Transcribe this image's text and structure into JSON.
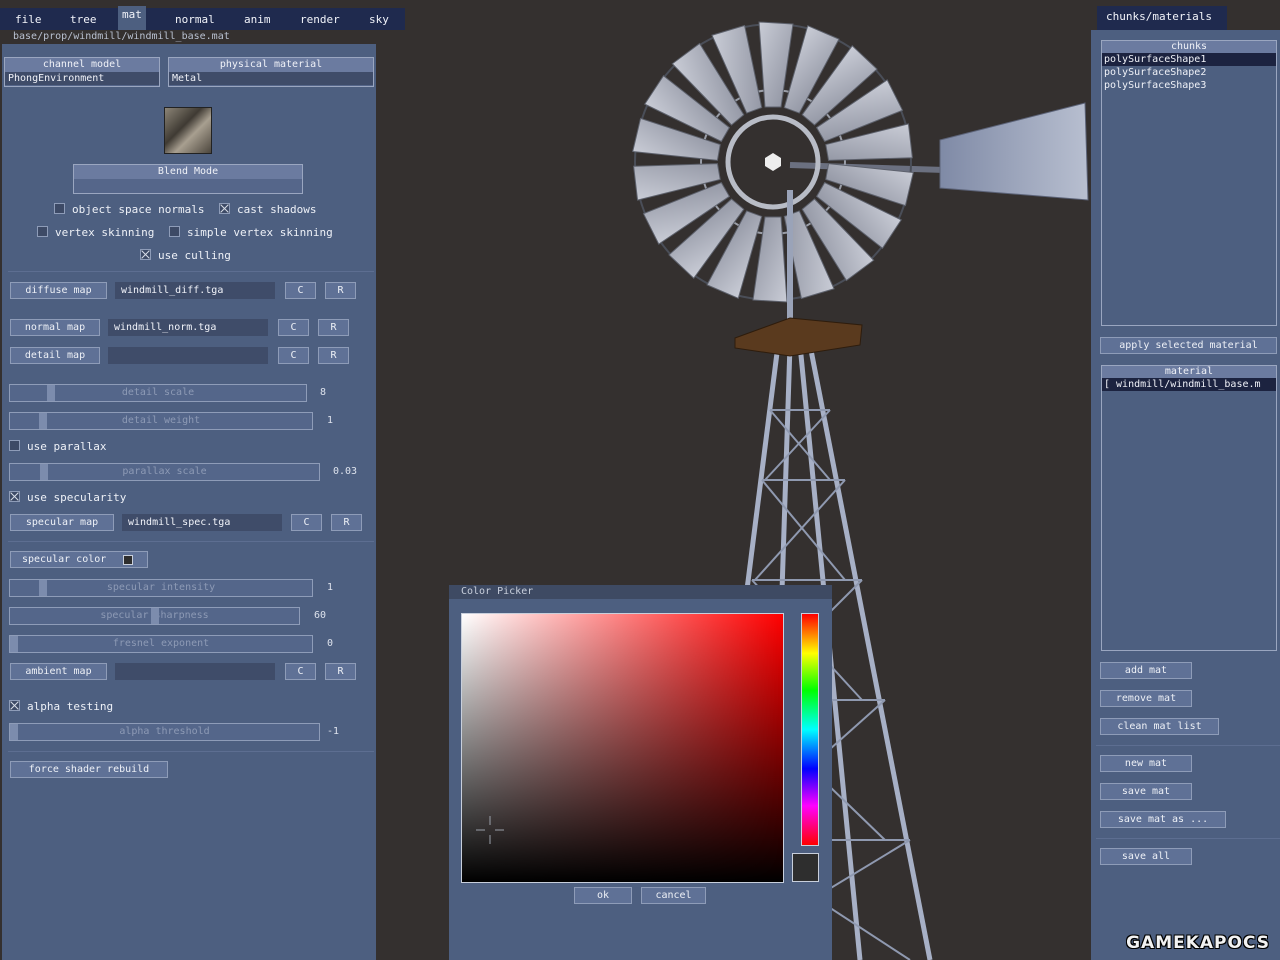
{
  "menu": {
    "items": [
      "file",
      "tree",
      "mat",
      "normal",
      "anim",
      "render",
      "sky"
    ],
    "active": "mat"
  },
  "path": "base/prop/windmill/windmill_base.mat",
  "left": {
    "channel_model": {
      "label": "channel model",
      "value": "PhongEnvironment"
    },
    "physical_material": {
      "label": "physical material",
      "value": "Metal"
    },
    "blend_mode": "Blend Mode",
    "checks": {
      "object_space_normals": {
        "label": "object space normals",
        "checked": false
      },
      "cast_shadows": {
        "label": "cast shadows",
        "checked": true
      },
      "vertex_skinning": {
        "label": "vertex skinning",
        "checked": false
      },
      "simple_vertex_skinning": {
        "label": "simple vertex skinning",
        "checked": false
      },
      "use_culling": {
        "label": "use culling",
        "checked": true
      },
      "use_parallax": {
        "label": "use parallax",
        "checked": false
      },
      "use_specularity": {
        "label": "use specularity",
        "checked": true
      },
      "alpha_testing": {
        "label": "alpha testing",
        "checked": true
      }
    },
    "maps": {
      "diffuse": {
        "label": "diffuse map",
        "file": "windmill_diff.tga"
      },
      "normal": {
        "label": "normal map",
        "file": "windmill_norm.tga"
      },
      "detail": {
        "label": "detail map",
        "file": ""
      },
      "specular": {
        "label": "specular map",
        "file": "windmill_spec.tga"
      },
      "ambient": {
        "label": "ambient map",
        "file": ""
      }
    },
    "c_label": "C",
    "r_label": "R",
    "sliders": {
      "detail_scale": {
        "label": "detail scale",
        "value": "8",
        "fraction": 0.13
      },
      "detail_weight": {
        "label": "detail weight",
        "value": "1",
        "fraction": 0.1
      },
      "parallax_scale": {
        "label": "parallax scale",
        "value": "0.03",
        "fraction": 0.1
      },
      "specular_intensity": {
        "label": "specular intensity",
        "value": "1",
        "fraction": 0.1
      },
      "specular_sharpness": {
        "label": "specular sharpness",
        "value": "60",
        "fraction": 0.5
      },
      "fresnel_exponent": {
        "label": "fresnel exponent",
        "value": "0",
        "fraction": 0.0
      },
      "alpha_threshold": {
        "label": "alpha threshold",
        "value": "-1",
        "fraction": 0.0
      }
    },
    "specular_color": "specular color",
    "force_rebuild": "force shader rebuild"
  },
  "right": {
    "tab": "chunks/materials",
    "chunks_header": "chunks",
    "chunks": [
      "polySurfaceShape1",
      "polySurfaceShape2",
      "polySurfaceShape3"
    ],
    "selected_chunk": 0,
    "apply_selected": "apply selected material",
    "material_header": "material",
    "materials": [
      "[ windmill/windmill_base.m"
    ],
    "buttons": {
      "add_mat": "add mat",
      "remove_mat": "remove mat",
      "clean_mat_list": "clean mat list",
      "new_mat": "new mat",
      "save_mat": "save mat",
      "save_mat_as": "save mat as ...",
      "save_all": "save all"
    }
  },
  "picker": {
    "title": "Color Picker",
    "ok": "ok",
    "cancel": "cancel",
    "current_color": "#2e2e2e"
  },
  "watermark": "GAMEKAPOCS"
}
